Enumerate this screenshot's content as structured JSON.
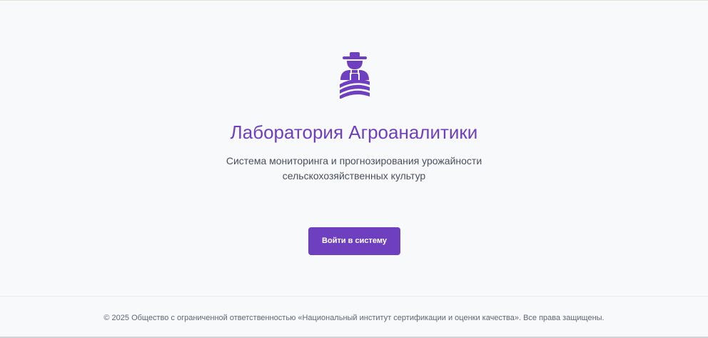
{
  "brand": {
    "logo_icon": "farmer-icon",
    "accent_color": "#6e40c0"
  },
  "hero": {
    "title": "Лаборатория Агроаналитики",
    "subtitle_line1": "Система мониторинга и прогнозирования урожайности",
    "subtitle_line2": "сельскохозяйственных культур"
  },
  "actions": {
    "login_label": "Войти в систему"
  },
  "footer": {
    "copyright": "© 2025 Общество с ограниченной ответственностью «Национальный институт сертификации и оценки качества». Все права защищены."
  }
}
